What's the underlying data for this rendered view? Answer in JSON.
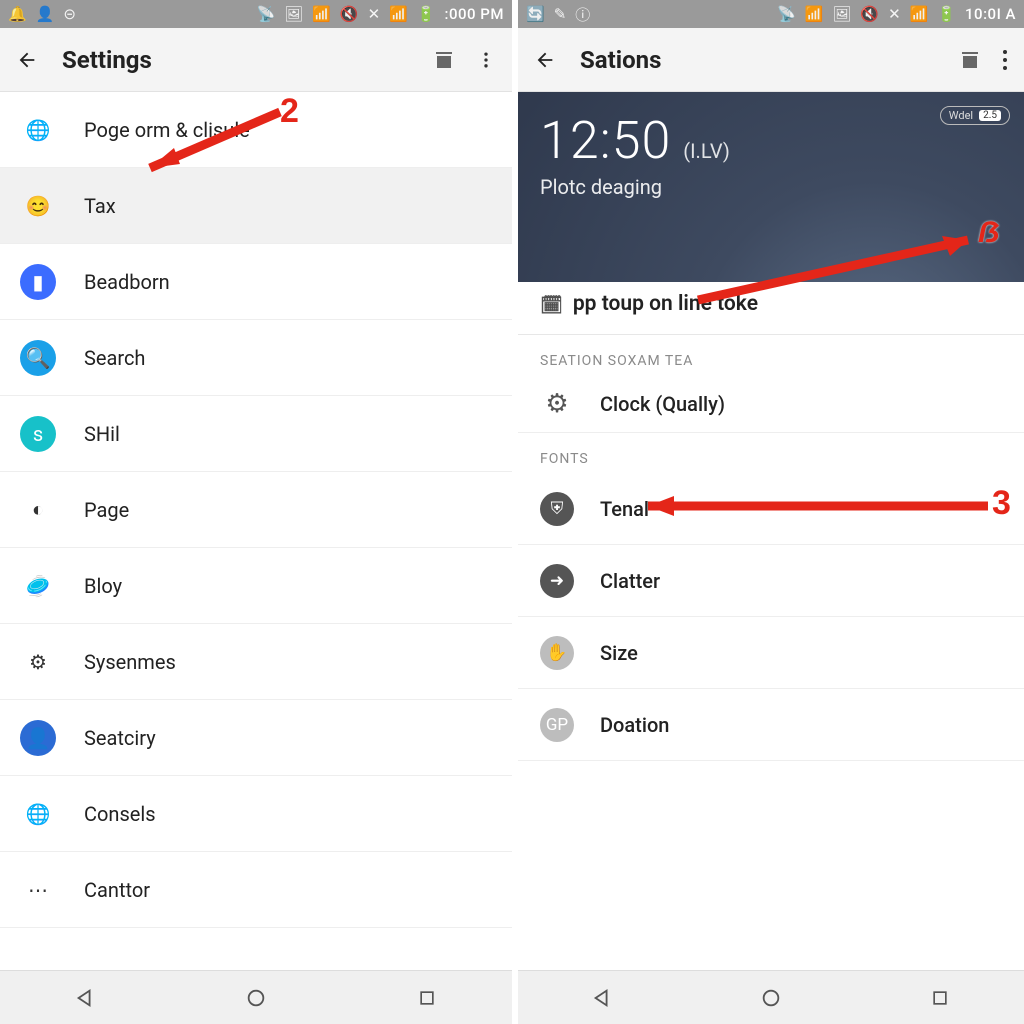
{
  "left": {
    "statusbar": {
      "left_icons": [
        "🔔",
        "👤",
        "⊝"
      ],
      "right_icons": [
        "📡",
        "🖼",
        "📶",
        "🔇",
        "✕",
        "📶",
        "🔋"
      ],
      "time": ":000 PM"
    },
    "appbar": {
      "title": "Settings"
    },
    "rows": [
      {
        "icon": "🌐",
        "icon_bg": "#ffffff",
        "label": "Poge orm & clisule"
      },
      {
        "icon": "😊",
        "icon_bg": "#f1f1f1",
        "label": "Tax",
        "selected": true
      },
      {
        "icon": "▮",
        "icon_bg": "#3b6cff",
        "label": "Beadborn"
      },
      {
        "icon": "🔍",
        "icon_bg": "#1aa0e8",
        "label": "Search"
      },
      {
        "icon": "s",
        "icon_bg": "#17c1c9",
        "label": "SHil"
      },
      {
        "icon": "◐",
        "icon_bg": "#ffffff",
        "label": "Page"
      },
      {
        "icon": "🥏",
        "icon_bg": "#ffffff",
        "label": "Bloy"
      },
      {
        "icon": "⚙",
        "icon_bg": "#ffffff",
        "label": "Sysenmes"
      },
      {
        "icon": "👤",
        "icon_bg": "#2b6bd4",
        "label": "Seatciry"
      },
      {
        "icon": "🌐",
        "icon_bg": "#ffffff",
        "label": "Consels"
      },
      {
        "icon": "⋯",
        "icon_bg": "#ffffff",
        "label": "Canttor"
      }
    ],
    "annotation": {
      "num": "2"
    }
  },
  "right": {
    "statusbar": {
      "left_icons": [
        "🔄",
        "✎",
        "ⓘ"
      ],
      "right_icons": [
        "📡",
        "📶",
        "🖼",
        "🔇",
        "✕",
        "📶",
        "🔋"
      ],
      "time": "10:0I A"
    },
    "appbar": {
      "title": "Sations"
    },
    "hero": {
      "time": "12:50",
      "ampm": "(I.LV)",
      "sub": "Plotc deaging",
      "pill_label": "Wdel",
      "pill_num": "2.5"
    },
    "card": {
      "big": "pp toup on line toke",
      "sections": [
        {
          "label": "SEATION SOXAM TEA",
          "rows": [
            {
              "icon": "⚙",
              "style": "gear",
              "label": "Clock (Qually)"
            }
          ]
        },
        {
          "label": "FONTS",
          "rows": [
            {
              "icon": "⛨",
              "style": "dark",
              "label": "Tenal"
            },
            {
              "icon": "➜",
              "style": "dark",
              "label": "Clatter"
            },
            {
              "icon": "✋",
              "style": "",
              "label": "Size"
            },
            {
              "icon": "GP",
              "style": "",
              "label": "Doation"
            }
          ]
        }
      ]
    },
    "annotation_top": {
      "glyph": "ẞ"
    },
    "annotation_mid": {
      "num": "3"
    }
  }
}
